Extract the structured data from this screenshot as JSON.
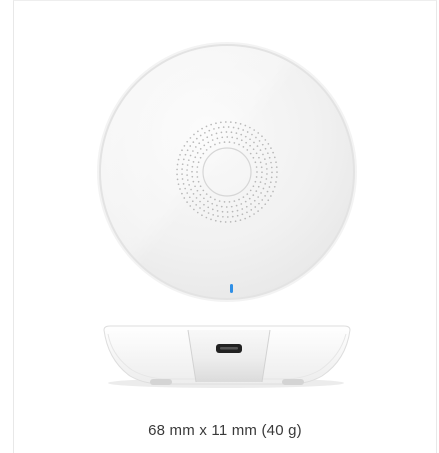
{
  "product": {
    "image_alt": "White round wireless charging pad, top view and side view",
    "caption": "68 mm x 11 mm (40 g)"
  },
  "colors": {
    "background": "#ffffff",
    "panel_border": "#e8e8e8",
    "pad_face": "#f3f3f3",
    "pad_rim": "#e2e2e2",
    "led": "#2f8fe6",
    "port": "#222222",
    "caption_text": "#3a3a3a"
  },
  "icons": {
    "led_indicator": "led-indicator-icon",
    "usb_port": "micro-usb-port-icon"
  }
}
